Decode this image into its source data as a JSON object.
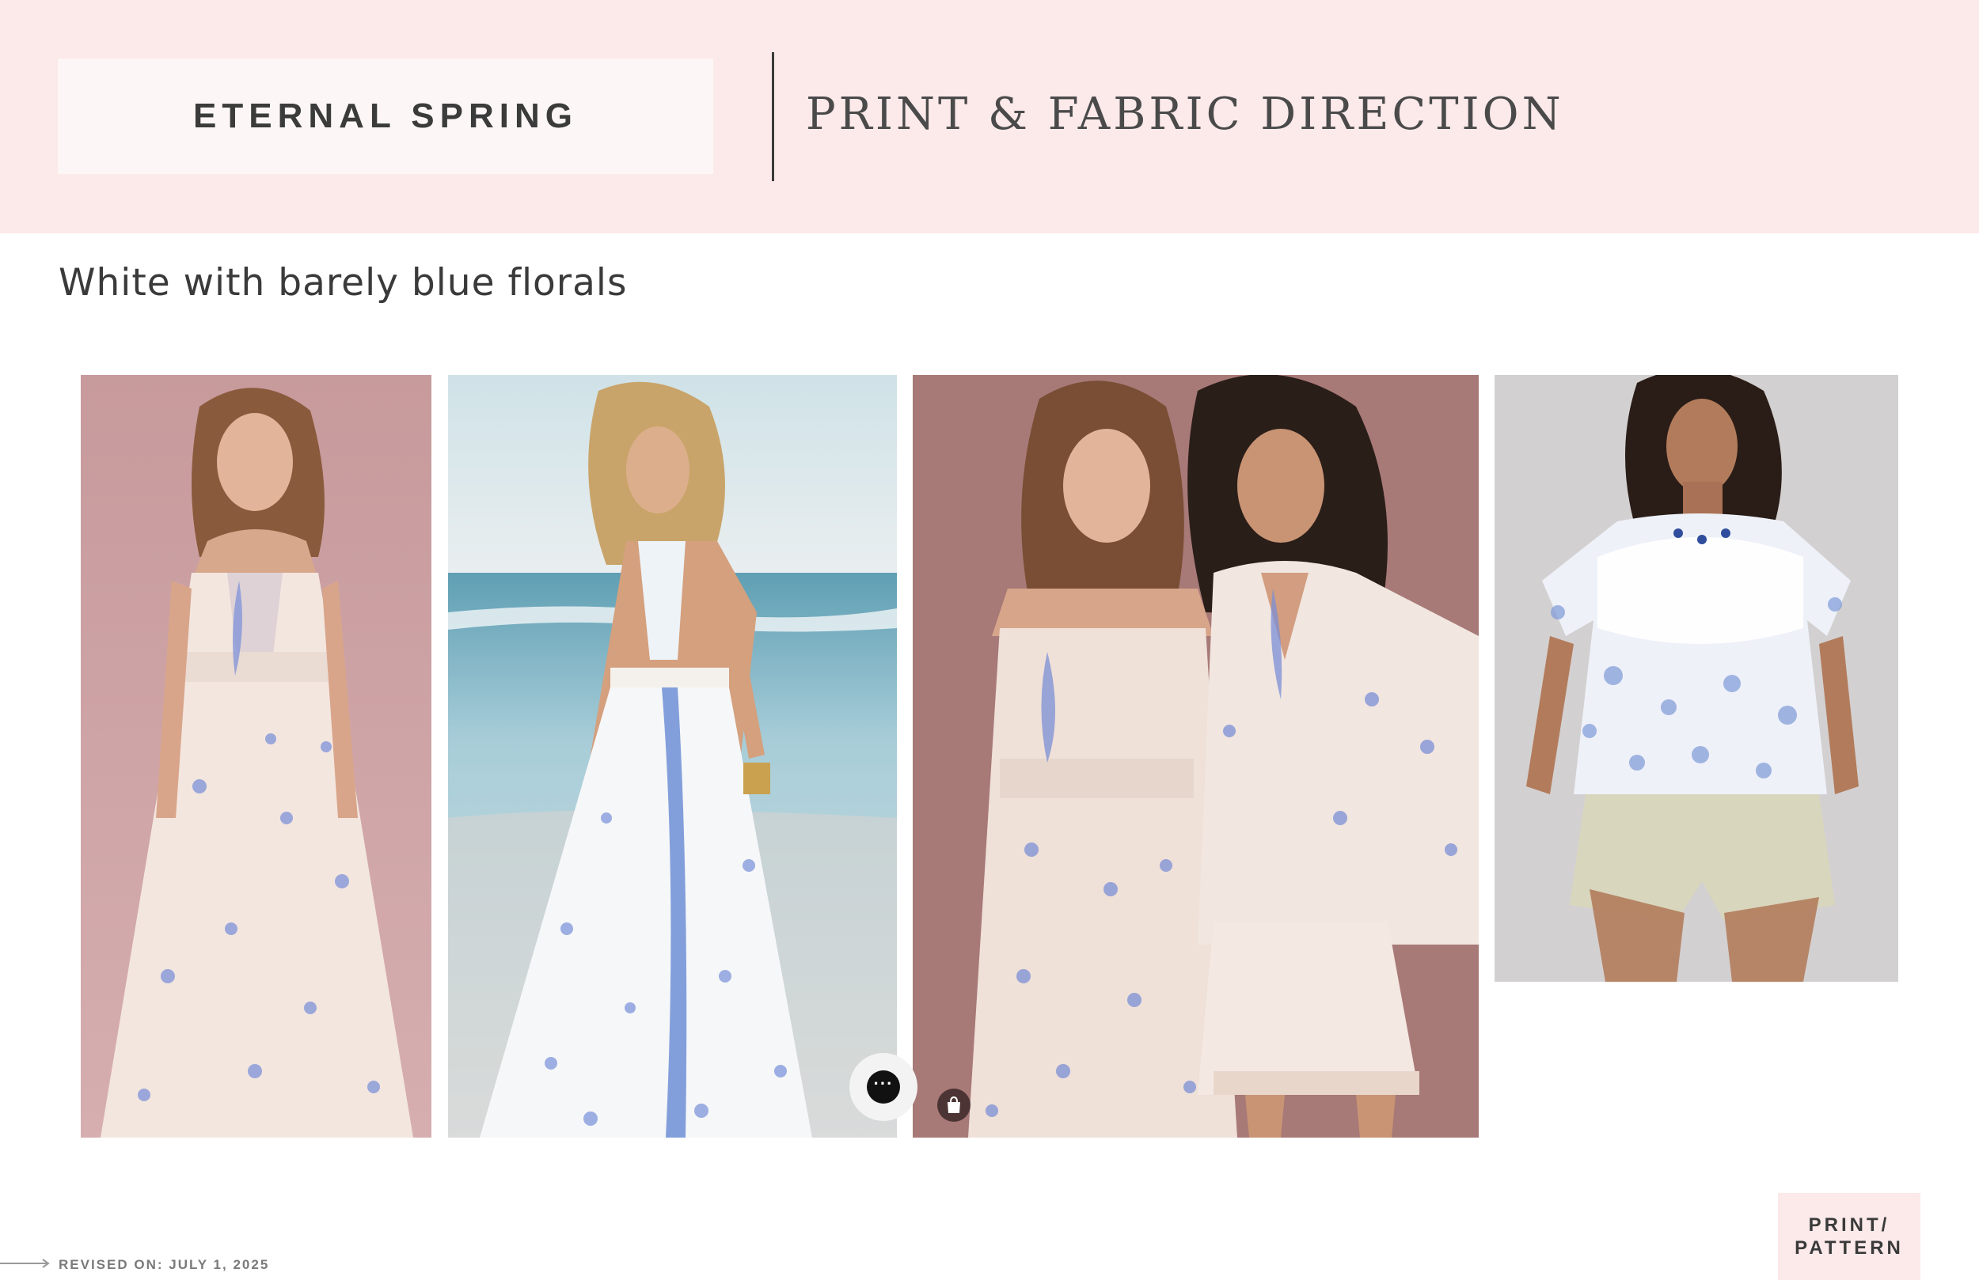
{
  "header": {
    "title": "ETERNAL SPRING",
    "section_title": "PRINT & FABRIC DIRECTION"
  },
  "subtitle": "White with barely blue florals",
  "photos": [
    {
      "name": "model-halter-maxi-dress-pink-backdrop"
    },
    {
      "name": "model-halter-maxi-dress-beach"
    },
    {
      "name": "two-models-dress-and-blouse-set"
    },
    {
      "name": "model-lace-yoke-top-with-shorts"
    }
  ],
  "overlays": {
    "chat_icon": "ellipsis-chat-icon",
    "chat_glyph": "···",
    "shop_icon": "shopping-bag-icon"
  },
  "footer": {
    "revised": "REVISED ON: JULY 1, 2025",
    "tag_line_1": "PRINT/",
    "tag_line_2": "PATTERN"
  },
  "colors": {
    "header_band": "#fce9ea",
    "title_box": "#fcf7f6",
    "text_dark": "#3a3a3a",
    "floral_blue": "#6f8fd6"
  }
}
